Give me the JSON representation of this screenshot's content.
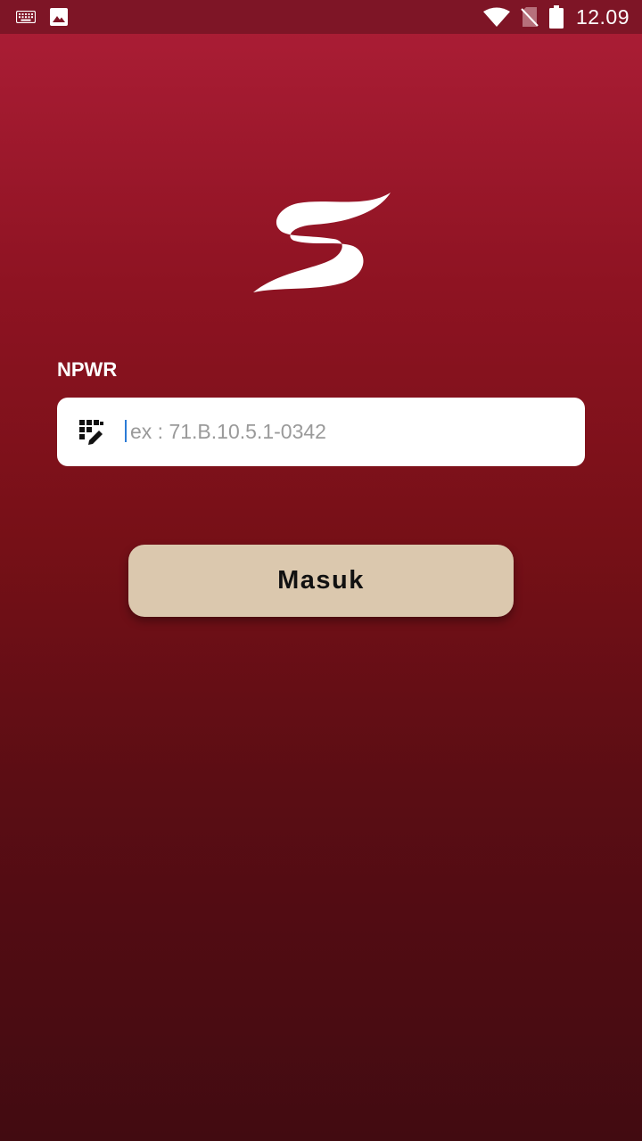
{
  "status_bar": {
    "time": "12.09",
    "left_icons": [
      "keyboard-icon",
      "image-icon"
    ],
    "right_icons": [
      "wifi-icon",
      "no-sim-icon",
      "battery-icon"
    ]
  },
  "logo": {
    "icon": "s-logo-icon",
    "color": "#ffffff"
  },
  "form": {
    "npwr_label": "NPWR",
    "npwr_placeholder": "ex : 71.B.10.5.1-0342",
    "npwr_value": "",
    "input_icon": "keypad-edit-icon",
    "submit_label": "Masuk"
  },
  "colors": {
    "background_top": "#ad1e37",
    "background_bottom": "#420b11",
    "status_bar": "#7e1526",
    "button": "#dbc8ae",
    "caret": "#2b7bd6"
  }
}
